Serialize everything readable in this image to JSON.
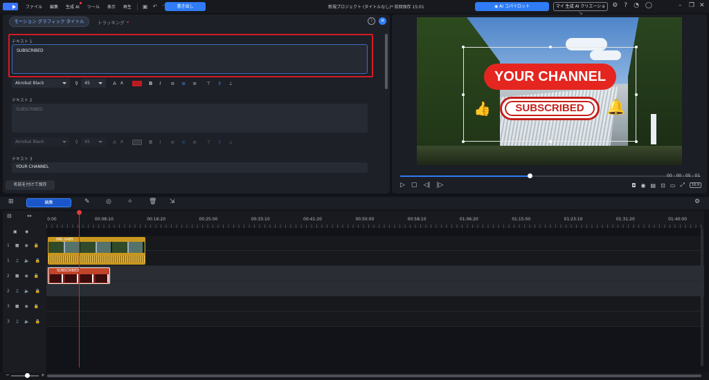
{
  "menubar": {
    "items": [
      "ファイル",
      "編集",
      "生成 AI",
      "ツール",
      "表示",
      "再生"
    ],
    "export_label": "書き出し",
    "project_title": "新規プロジェクト (タイトルなし)* 前回保存 15:01",
    "copilot_label": "AI コパイロット",
    "creations_label": "マイ 生成 AI クリエーション"
  },
  "editor": {
    "tab_active": "モーション グラフィック タイトル",
    "tab_tracking": "トラッキング",
    "tracking_mark": "*",
    "fields": [
      {
        "label": "テキスト 1",
        "value": "SUBSCRIBED"
      },
      {
        "label": "テキスト 2",
        "value": "SUBSCRIBED"
      },
      {
        "label": "テキスト 3",
        "value": "YOUR CHANNEL"
      }
    ],
    "font_name": "Akrobat Black",
    "font_size": "45",
    "save_as_label": "名前を付けて保存"
  },
  "preview": {
    "channel_text": "YOUR CHANNEL",
    "subscribed_text": "SUBSCRIBED",
    "timecode": "00 : 00 : 05 : 01",
    "progress": 0.43,
    "aspect_ratio": "16:9"
  },
  "timeline": {
    "edit_label": "編集",
    "ruler_labels": [
      "0:00",
      "00:08:10",
      "00:16:20",
      "00:25:00",
      "00:33:10",
      "00:41:20",
      "00:50:00",
      "00:58:10",
      "01:06:20",
      "01:15:00",
      "01:23:10",
      "01:31:20",
      "01:40:00"
    ],
    "video_clip_name": "IMG_6485",
    "title_clip_name": "SUBSCRIBED",
    "track_numbers": [
      "1",
      "1",
      "2",
      "2",
      "3",
      "3"
    ]
  },
  "colors": {
    "accent": "#2f7cf6",
    "highlight": "#d51b23",
    "channel_red": "#e52620"
  }
}
